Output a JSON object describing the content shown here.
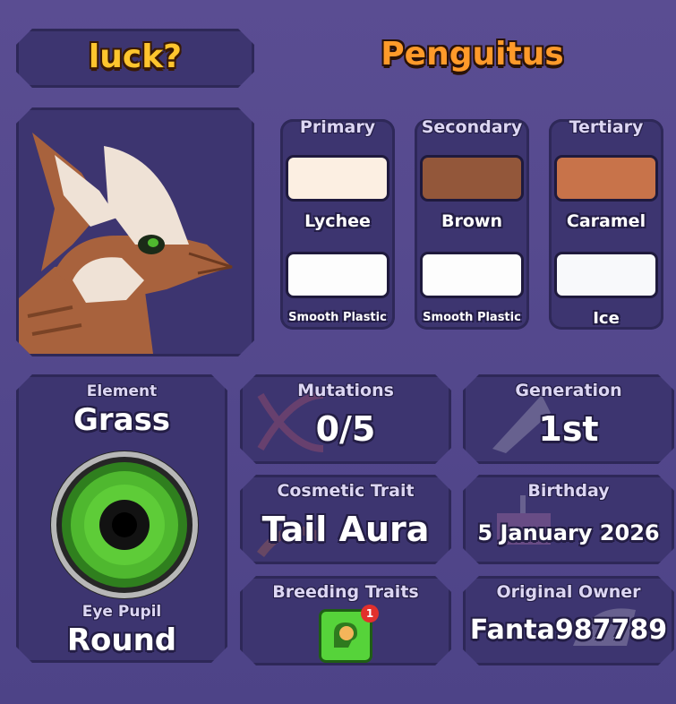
{
  "header": {
    "nickname": "luck?",
    "species": "Penguitus"
  },
  "colors": [
    {
      "slot": "Primary",
      "color_name": "Lychee",
      "color_hex": "#fcefe2",
      "material": "Smooth Plastic",
      "material_hex": "#fdfdfd"
    },
    {
      "slot": "Secondary",
      "color_name": "Brown",
      "color_hex": "#93573a",
      "material": "Smooth Plastic",
      "material_hex": "#fdfdfd"
    },
    {
      "slot": "Tertiary",
      "color_name": "Caramel",
      "color_hex": "#c8734a",
      "material": "Ice",
      "material_hex": "#f8f9fb"
    }
  ],
  "element": {
    "label": "Element",
    "value": "Grass"
  },
  "eye": {
    "label": "Eye Pupil",
    "value": "Round",
    "iris_color": "#4fb82f",
    "icon": "eye-icon"
  },
  "mutations": {
    "label": "Mutations",
    "value": "0/5"
  },
  "generation": {
    "label": "Generation",
    "value": "1st"
  },
  "cosmetic": {
    "label": "Cosmetic Trait",
    "value": "Tail Aura"
  },
  "birthday": {
    "label": "Birthday",
    "value": "5 January 2026"
  },
  "breeding": {
    "label": "Breeding Traits",
    "badge_count": "1",
    "icon": "brain-trait-icon"
  },
  "owner": {
    "label": "Original Owner",
    "value": "Fanta987789"
  },
  "theme": {
    "panel": "#4f4482",
    "card": "#3d3570",
    "gold": "#ffc52e",
    "orange": "#ff9a2a"
  }
}
